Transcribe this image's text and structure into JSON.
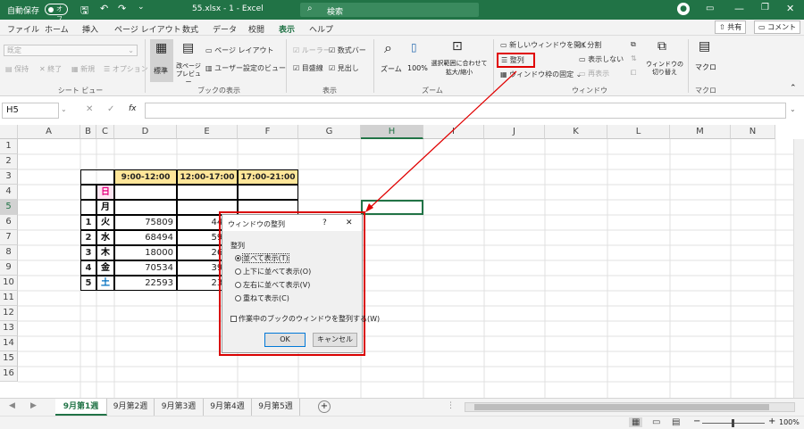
{
  "titlebar": {
    "autosave_label": "自動保存",
    "autosave_state": "オフ",
    "file_name": "55.xlsx - 1 - Excel",
    "search_placeholder": "検索"
  },
  "ribbon_tabs": [
    "ファイル",
    "ホーム",
    "挿入",
    "ページ レイアウト",
    "数式",
    "データ",
    "校閲",
    "表示",
    "ヘルプ"
  ],
  "active_tab": "表示",
  "share_label": "共有",
  "comment_label": "コメント",
  "ribbon": {
    "sheetview": {
      "dropdown": "既定",
      "keep": "保持",
      "end": "終了",
      "new": "新規",
      "options": "オプション",
      "group": "シート ビュー"
    },
    "bookview": {
      "normal": "標準",
      "pagebreak": "改ページ プレビュー",
      "pagelayout": "ページ レイアウト",
      "custom": "ユーザー設定のビュー",
      "group": "ブックの表示"
    },
    "show": {
      "ruler": "ルーラー",
      "formulabar": "数式バー",
      "gridlines": "目盛線",
      "headings": "見出し",
      "group": "表示"
    },
    "zoom": {
      "zoom": "ズーム",
      "hundred": "100%",
      "fit": "選択範囲に合わせて 拡大/縮小",
      "group": "ズーム"
    },
    "window": {
      "new": "新しいウィンドウを開く",
      "arrange": "整列",
      "freeze": "ウィンドウ枠の固定",
      "split": "分割",
      "hide": "表示しない",
      "unhide": "再表示",
      "switch": "ウィンドウの 切り替え",
      "group": "ウィンドウ"
    },
    "macro": {
      "macro": "マクロ",
      "group": "マクロ"
    }
  },
  "namebox": "H5",
  "fx_label": "fx",
  "columns": [
    "A",
    "B",
    "C",
    "D",
    "E",
    "F",
    "G",
    "H",
    "I",
    "J",
    "K",
    "L",
    "M",
    "N"
  ],
  "rows": [
    "1",
    "2",
    "3",
    "4",
    "5",
    "6",
    "7",
    "8",
    "9",
    "10",
    "11",
    "12",
    "13",
    "14",
    "15",
    "16"
  ],
  "table": {
    "headers": [
      "9:00-12:00",
      "12:00-17:00",
      "17:00-21:00"
    ],
    "days": [
      {
        "n": "",
        "d": "日"
      },
      {
        "n": "",
        "d": "月"
      },
      {
        "n": "1",
        "d": "火"
      },
      {
        "n": "2",
        "d": "水"
      },
      {
        "n": "3",
        "d": "木"
      },
      {
        "n": "4",
        "d": "金"
      },
      {
        "n": "5",
        "d": "土"
      }
    ],
    "d_values": [
      "",
      "",
      "75809",
      "68494",
      "18000",
      "70534",
      "22593"
    ],
    "e_values": [
      "",
      "",
      "4457",
      "5945",
      "2682",
      "3951",
      "2364"
    ]
  },
  "sheet_tabs": [
    "9月第1週",
    "9月第2週",
    "9月第3週",
    "9月第4週",
    "9月第5週"
  ],
  "active_sheet": "9月第1週",
  "zoom_level": "100%",
  "dialog": {
    "title": "ウィンドウの整列",
    "help": "?",
    "close": "✕",
    "group_label": "整列",
    "options": [
      "並べて表示(T)",
      "上下に並べて表示(O)",
      "左右に並べて表示(V)",
      "重ねて表示(C)"
    ],
    "checkbox": "作業中のブックのウィンドウを整列する(W)",
    "ok": "OK",
    "cancel": "キャンセル"
  },
  "colors": {
    "excel_green": "#217346",
    "header_fill": "#ffe699",
    "sunday": "#e6007e",
    "saturday": "#0070c0",
    "highlight": "#e00000"
  }
}
